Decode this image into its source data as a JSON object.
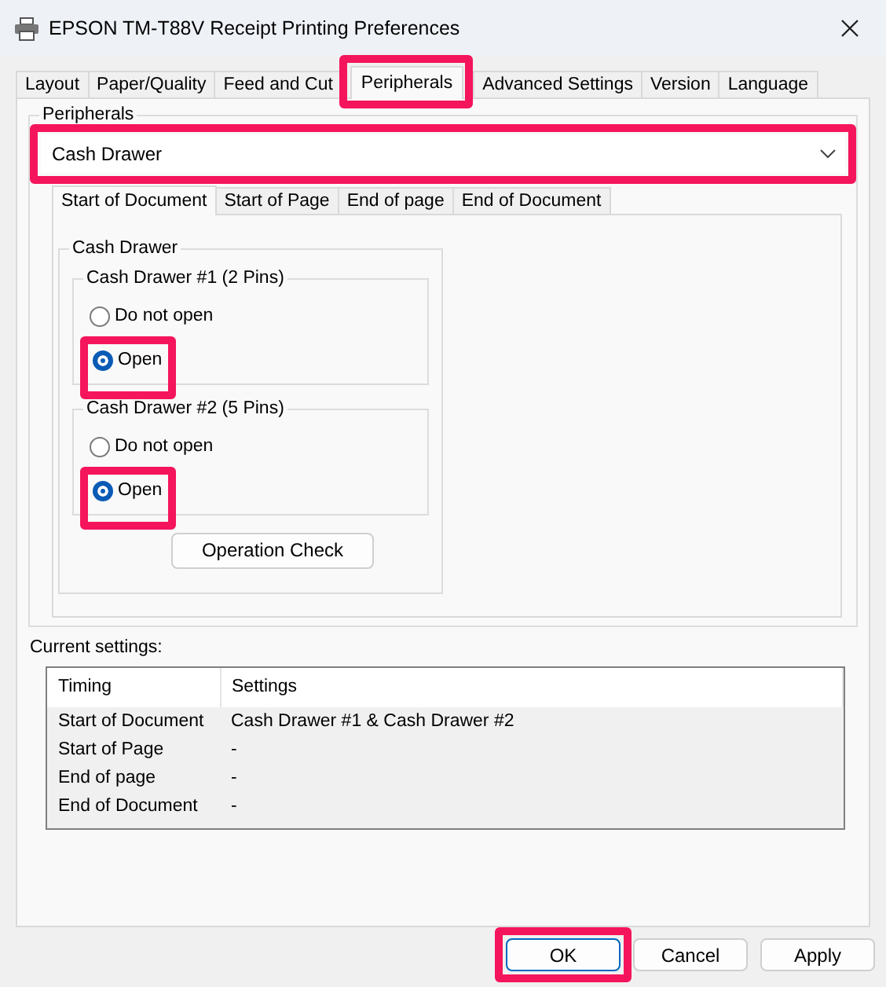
{
  "window": {
    "title": "EPSON TM-T88V Receipt Printing Preferences"
  },
  "tabs": [
    {
      "label": "Layout",
      "selected": false,
      "highlighted": false
    },
    {
      "label": "Paper/Quality",
      "selected": false,
      "highlighted": false
    },
    {
      "label": "Feed and Cut",
      "selected": false,
      "highlighted": false
    },
    {
      "label": "Peripherals",
      "selected": true,
      "highlighted": true
    },
    {
      "label": "Advanced Settings",
      "selected": false,
      "highlighted": false
    },
    {
      "label": "Version",
      "selected": false,
      "highlighted": false
    },
    {
      "label": "Language",
      "selected": false,
      "highlighted": false
    }
  ],
  "peripherals": {
    "label": "Peripherals",
    "device": {
      "value": "Cash Drawer",
      "highlighted": true
    }
  },
  "timing_tabs": [
    {
      "label": "Start of Document",
      "selected": true
    },
    {
      "label": "Start of Page",
      "selected": false
    },
    {
      "label": "End of page",
      "selected": false
    },
    {
      "label": "End of Document",
      "selected": false
    }
  ],
  "cash_drawer": {
    "label": "Cash Drawer",
    "drawers": [
      {
        "label": "Cash Drawer #1 (2 Pins)",
        "options": [
          {
            "label": "Do not open",
            "selected": false,
            "highlighted": false
          },
          {
            "label": "Open",
            "selected": true,
            "highlighted": true
          }
        ]
      },
      {
        "label": "Cash Drawer #2 (5 Pins)",
        "options": [
          {
            "label": "Do not open",
            "selected": false,
            "highlighted": false
          },
          {
            "label": "Open",
            "selected": true,
            "highlighted": true
          }
        ]
      }
    ],
    "button": "Operation Check"
  },
  "current_settings": {
    "label": "Current settings:",
    "columns": [
      "Timing",
      "Settings"
    ],
    "rows": [
      [
        "Start of Document",
        "Cash Drawer #1 & Cash Drawer #2"
      ],
      [
        "Start of Page",
        "-"
      ],
      [
        "End of page",
        "-"
      ],
      [
        "End of Document",
        "-"
      ]
    ]
  },
  "buttons": [
    {
      "label": "OK",
      "default": true,
      "highlighted": true
    },
    {
      "label": "Cancel",
      "default": false,
      "highlighted": false
    },
    {
      "label": "Apply",
      "default": false,
      "highlighted": false
    }
  ]
}
